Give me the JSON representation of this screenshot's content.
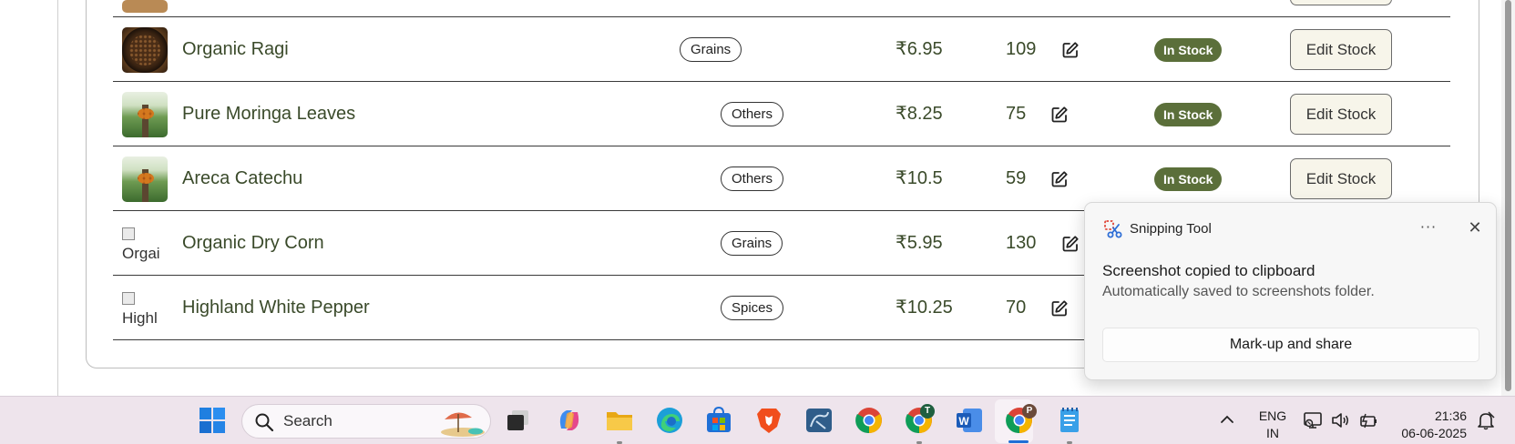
{
  "table": {
    "rows": [
      {
        "name": "Organic Ragi",
        "category": "Grains",
        "price": "₹6.95",
        "quantity": "109",
        "status": "In Stock",
        "action": "Edit Stock",
        "image": "ragi"
      },
      {
        "name": "Pure Moringa Leaves",
        "category": "Others",
        "price": "₹8.25",
        "quantity": "75",
        "status": "In Stock",
        "action": "Edit Stock",
        "image": "palm"
      },
      {
        "name": "Areca Catechu",
        "category": "Others",
        "price": "₹10.5",
        "quantity": "59",
        "status": "In Stock",
        "action": "Edit Stock",
        "image": "palm"
      },
      {
        "name": "Organic Dry Corn",
        "category": "Grains",
        "price": "₹5.95",
        "quantity": "130",
        "image_alt": "Orgai"
      },
      {
        "name": "Highland White Pepper",
        "category": "Spices",
        "price": "₹10.25",
        "quantity": "70",
        "image_alt": "Highl"
      }
    ],
    "status_color": "#5b6f3a"
  },
  "toast": {
    "app_name": "Snipping Tool",
    "more_label": "···",
    "title": "Screenshot copied to clipboard",
    "body": "Automatically saved to screenshots folder.",
    "action_label": "Mark-up and share"
  },
  "taskbar": {
    "search_label": "Search",
    "lang_line1": "ENG",
    "lang_line2": "IN",
    "time": "21:36",
    "date": "06-06-2025",
    "chrome_badge_1": "T",
    "chrome_badge_2": "P",
    "icons": [
      "windows-start-icon",
      "search-icon",
      "task-view-icon",
      "copilot-icon",
      "file-explorer-icon",
      "edge-icon",
      "store-icon",
      "brave-icon",
      "mysql-workbench-icon",
      "chrome-icon",
      "chrome-profile-t-icon",
      "word-icon",
      "chrome-profile-p-icon",
      "notepad-icon"
    ]
  }
}
